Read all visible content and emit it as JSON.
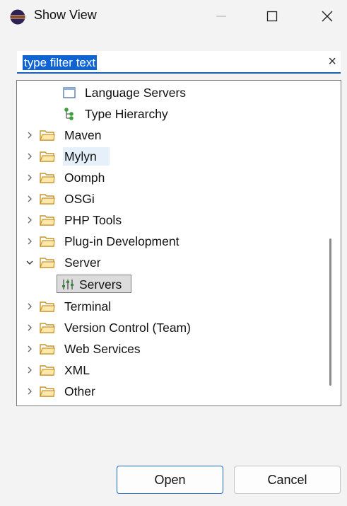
{
  "window": {
    "title": "Show View",
    "controls": {
      "minimize": "minimize-icon",
      "maximize": "maximize-icon",
      "close": "close-icon"
    }
  },
  "filter": {
    "value": "type filter text",
    "clear_glyph": "×"
  },
  "tree": {
    "top_children": [
      {
        "label": "Language Servers",
        "icon": "view-icon"
      },
      {
        "label": "Type Hierarchy",
        "icon": "type-hierarchy-icon"
      }
    ],
    "categories": [
      {
        "label": "Maven",
        "expanded": false
      },
      {
        "label": "Mylyn",
        "expanded": false,
        "hovered": true
      },
      {
        "label": "Oomph",
        "expanded": false
      },
      {
        "label": "OSGi",
        "expanded": false
      },
      {
        "label": "PHP Tools",
        "expanded": false
      },
      {
        "label": "Plug-in Development",
        "expanded": false
      },
      {
        "label": "Server",
        "expanded": true
      },
      {
        "label": "Terminal",
        "expanded": false
      },
      {
        "label": "Version Control (Team)",
        "expanded": false
      },
      {
        "label": "Web Services",
        "expanded": false
      },
      {
        "label": "XML",
        "expanded": false
      },
      {
        "label": "Other",
        "expanded": false
      }
    ],
    "server_children": [
      {
        "label": "Servers",
        "icon": "servers-icon",
        "selected": true
      }
    ]
  },
  "buttons": {
    "open": "Open",
    "cancel": "Cancel"
  },
  "colors": {
    "accent": "#0f64d2",
    "folder": "#e8b84a",
    "selection": "#dcdcdc",
    "hover": "#e6f0fb"
  }
}
